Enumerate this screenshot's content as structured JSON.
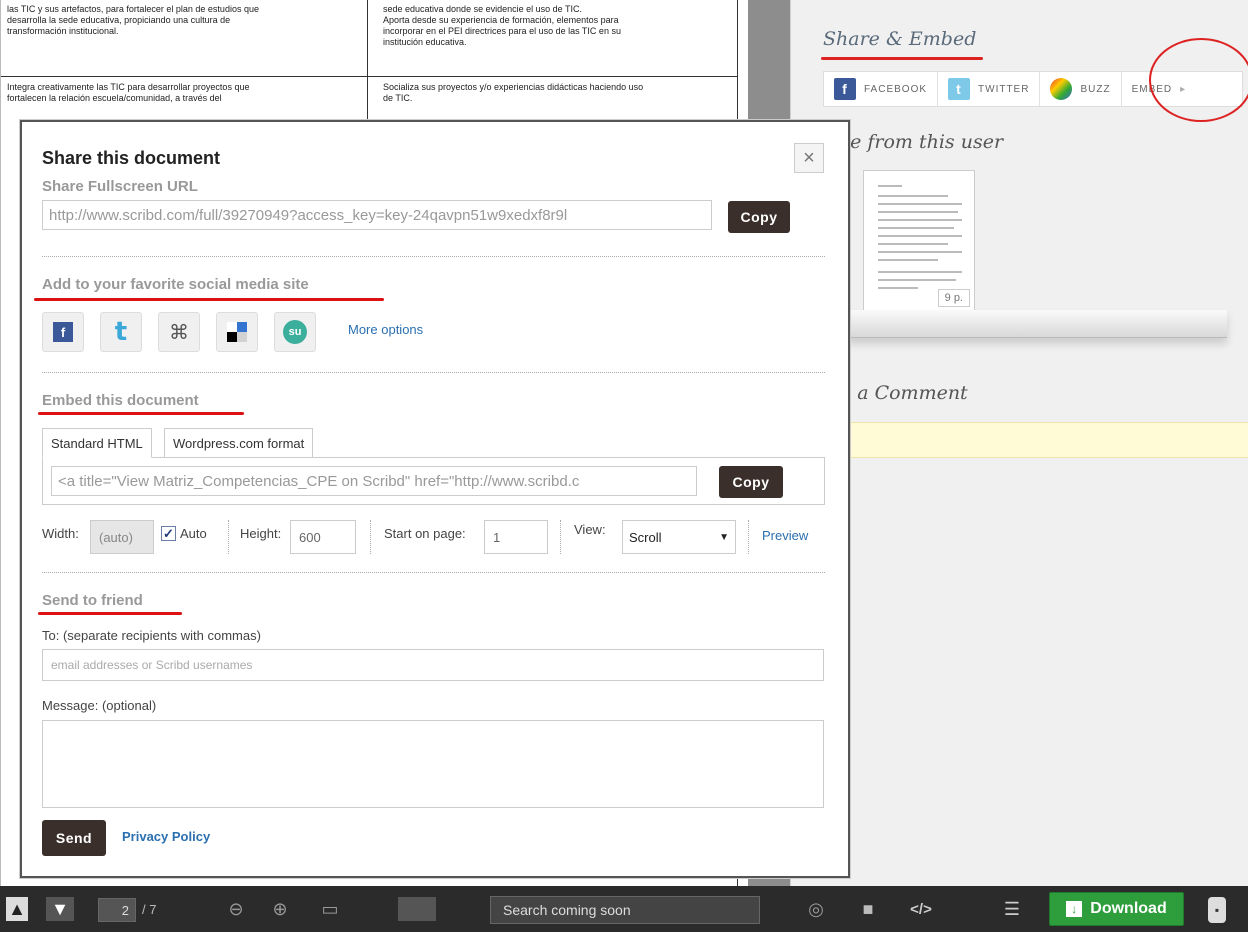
{
  "document": {
    "rows": [
      "las TIC y sus artefactos, para fortalecer el plan de estudios que",
      "desarrolla la sede educativa, propiciando una cultura de",
      "transformación institucional.",
      "sede educativa donde se evidencie el uso de TIC.",
      "Aporta desde su experiencia de formación, elementos para",
      "incorporar en el PEI directrices para el uso de las TIC en su",
      "institución educativa.",
      "Integra creativamente las TIC para desarrollar proyectos que",
      "fortalecen la relación escuela/comunidad, a través del",
      "Socializa sus proyectos y/o experiencias didácticas haciendo uso",
      "de TIC."
    ]
  },
  "right_panel": {
    "share_embed_title": "Share & Embed",
    "share_buttons": [
      "FACEBOOK",
      "TWITTER",
      "BUZZ",
      "EMBED"
    ],
    "more_from_user": "re from this user",
    "thumb_pages": "9 p.",
    "comment_title": "d a Comment"
  },
  "modal": {
    "title": "Share this document",
    "close": "×",
    "fullscreen_heading": "Share Fullscreen URL",
    "fullscreen_url": "http://www.scribd.com/full/39270949?access_key=key-24qavpn51w9xedxf8r9l",
    "copy_label": "Copy",
    "social_heading": "Add to your favorite social media site",
    "more_options": "More options",
    "embed_heading": "Embed this document",
    "tabs": [
      "Standard HTML",
      "Wordpress.com format"
    ],
    "embed_code": "<a title=\"View Matriz_Competencias_CPE on Scribd\" href=\"http://www.scribd.c",
    "width_label": "Width:",
    "width_value": "(auto)",
    "auto_label": "Auto",
    "height_label": "Height:",
    "height_value": "600",
    "start_label": "Start on page:",
    "start_value": "1",
    "view_label": "View:",
    "view_value": "Scroll",
    "preview": "Preview",
    "friend_heading": "Send to friend",
    "to_label": "To: (separate recipients with commas)",
    "to_placeholder": "email addresses or Scribd usernames",
    "message_label": "Message: (optional)",
    "send": "Send",
    "privacy": "Privacy Policy"
  },
  "toolbar": {
    "page_current": "2",
    "page_total": "/ 7",
    "search_placeholder": "Search coming soon",
    "download": "Download"
  },
  "colors": {
    "annotation_red": "#dd1111",
    "download_green": "#2e9e3c",
    "link_blue": "#2a6fb0"
  }
}
